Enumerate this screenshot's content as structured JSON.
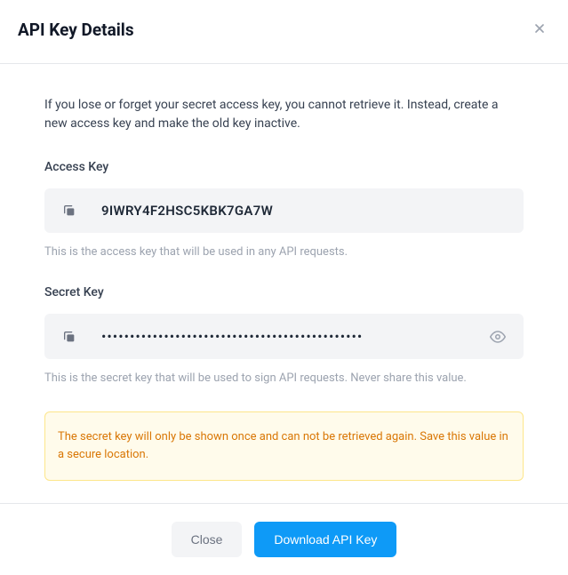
{
  "header": {
    "title": "API Key Details"
  },
  "body": {
    "intro": "If you lose or forget your secret access key, you cannot retrieve it. Instead, create a new access key and make the old key inactive.",
    "accessKey": {
      "label": "Access Key",
      "value": "9IWRY4F2HSC5KBK7GA7W",
      "hint": "This is the access key that will be used in any API requests."
    },
    "secretKey": {
      "label": "Secret Key",
      "masked": "••••••••••••••••••••••••••••••••••••••••••••••",
      "hint": "This is the secret key that will be used to sign API requests. Never share this value."
    },
    "warning": "The secret key will only be shown once and can not be retrieved again. Save this value in a secure location."
  },
  "footer": {
    "close": "Close",
    "download": "Download API Key"
  }
}
